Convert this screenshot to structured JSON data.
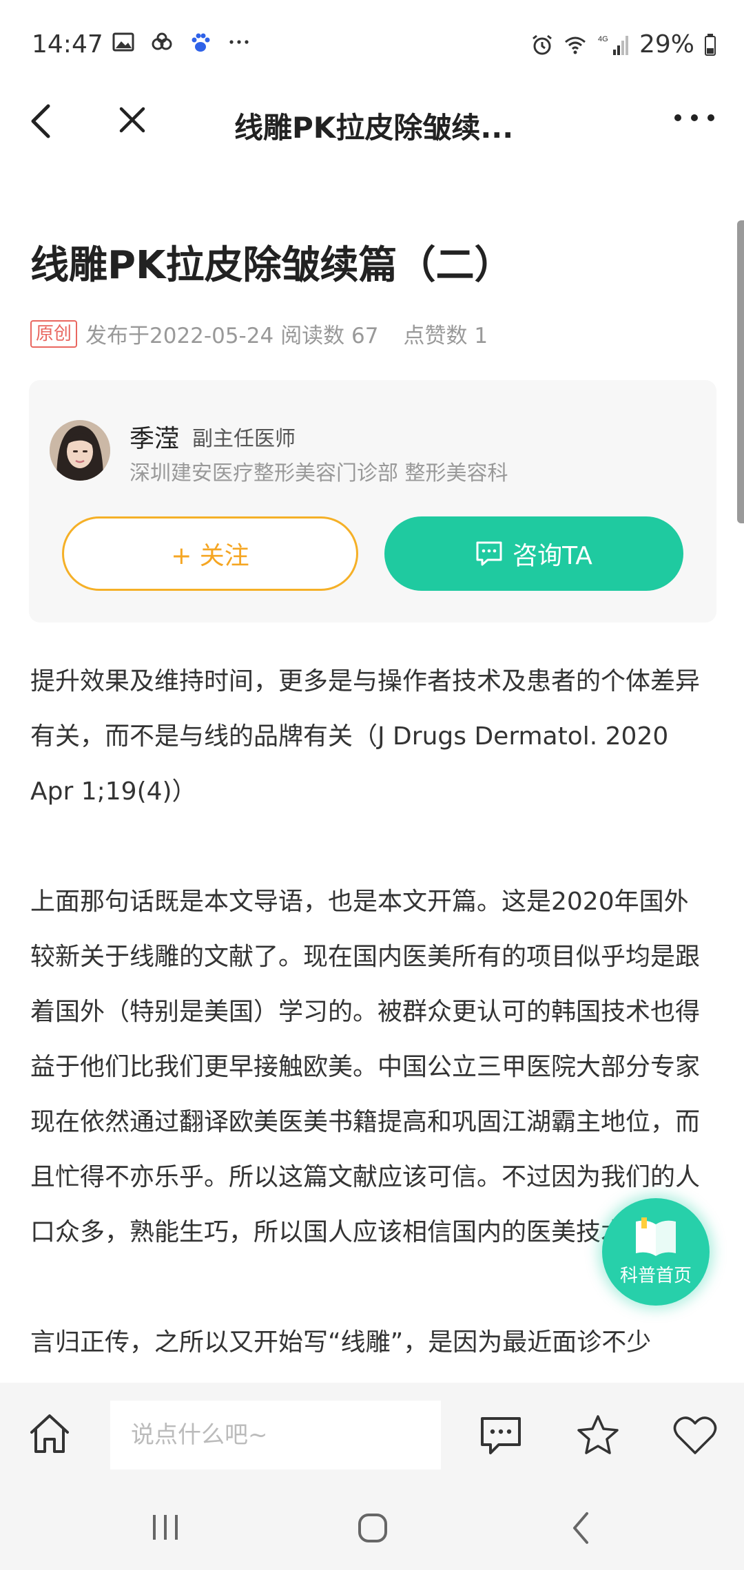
{
  "status": {
    "time": "14:47",
    "battery": "29%",
    "network": "4G"
  },
  "nav": {
    "title": "线雕PK拉皮除皱续..."
  },
  "article": {
    "title": "线雕PK拉皮除皱续篇（二）",
    "badge": "原创",
    "published": "发布于2022-05-24",
    "reads": "阅读数 67",
    "likes": "点赞数 1",
    "paragraphs": [
      "提升效果及维持时间，更多是与操作者技术及患者的个体差异有关，而不是与线的品牌有关（J Drugs Dermatol. 2020 Apr 1;19(4)）",
      "上面那句话既是本文导语，也是本文开篇。这是2020年国外较新关于线雕的文献了。现在国内医美所有的项目似乎均是跟着国外（特别是美国）学习的。被群众更认可的韩国技术也得益于他们比我们更早接触欧美。中国公立三甲医院大部分专家现在依然通过翻译欧美医美书籍提高和巩固江湖霸主地位，而且忙得不亦乐乎。所以这篇文献应该可信。不过因为我们的人口众多，熟能生巧，所以国人应该相信国内的医美技术。",
      "言归正传，之所以又开始写“线雕”，是因为最近面诊不少"
    ]
  },
  "author": {
    "name": "季滢",
    "title": "副主任医师",
    "org": "深圳建安医疗整形美容门诊部 整形美容科",
    "follow_label": "+ 关注",
    "consult_label": "咨询TA"
  },
  "float_button": {
    "label": "科普首页"
  },
  "bottom_bar": {
    "comment_placeholder": "说点什么吧~"
  },
  "colors": {
    "accent_green": "#1fcaa0",
    "accent_orange": "#f5a623",
    "badge_red": "#e9665f"
  }
}
